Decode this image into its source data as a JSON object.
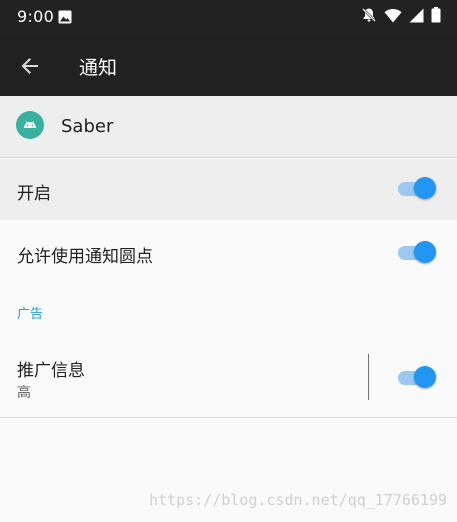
{
  "status_bar": {
    "time": "9:00",
    "icons": [
      "image-icon",
      "notifications-off-icon",
      "wifi-icon",
      "cell-signal-icon",
      "battery-icon"
    ]
  },
  "toolbar": {
    "title": "通知",
    "back_icon": "arrow-back-icon"
  },
  "app": {
    "name": "Saber",
    "icon": "android-app-icon",
    "icon_color": "#3ab09e"
  },
  "settings": {
    "main_toggle": {
      "label": "开启",
      "enabled": true
    },
    "dots_toggle": {
      "label": "允许使用通知圆点",
      "enabled": true
    }
  },
  "section": {
    "header": "广告"
  },
  "channel": {
    "label": "推广信息",
    "importance": "高",
    "enabled": true
  },
  "watermark": "https://blog.csdn.net/qq_17766199",
  "colors": {
    "accent": "#2196f3",
    "section_header": "#2b9fd9",
    "toolbar": "#212121"
  }
}
